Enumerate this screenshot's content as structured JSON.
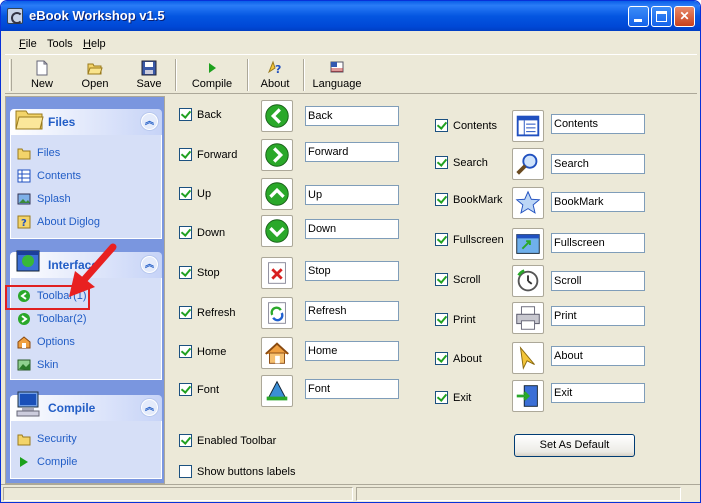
{
  "window": {
    "title": "eBook Workshop v1.5"
  },
  "menu": [
    {
      "label": "File",
      "u": "F",
      "rest": "ile"
    },
    {
      "label": "Tools",
      "u": "",
      "rest": "Tools"
    },
    {
      "label": "Help",
      "u": "H",
      "rest": "elp"
    }
  ],
  "toolbar": {
    "new": "New",
    "open": "Open",
    "save": "Save",
    "compile": "Compile",
    "about": "About",
    "language": "Language"
  },
  "sidebar": {
    "files": {
      "title": "Files",
      "items": [
        "Files",
        "Contents",
        "Splash",
        "About Diglog"
      ]
    },
    "interface": {
      "title": "Interface",
      "items": [
        "Toolbar(1)",
        "Toolbar(2)",
        "Options",
        "Skin"
      ]
    },
    "compile": {
      "title": "Compile",
      "items": [
        "Security",
        "Compile"
      ]
    }
  },
  "left_buttons": [
    {
      "label": "Back",
      "value": "Back",
      "checked": true,
      "icon": "arrow-left-icon"
    },
    {
      "label": "Forward",
      "value": "Forward",
      "checked": true,
      "icon": "arrow-right-icon"
    },
    {
      "label": "Up",
      "value": "Up",
      "checked": true,
      "icon": "arrow-up-icon"
    },
    {
      "label": "Down",
      "value": "Down",
      "checked": true,
      "icon": "arrow-down-icon"
    },
    {
      "label": "Stop",
      "value": "Stop",
      "checked": true,
      "icon": "stop-icon"
    },
    {
      "label": "Refresh",
      "value": "Refresh",
      "checked": true,
      "icon": "refresh-icon"
    },
    {
      "label": "Home",
      "value": "Home",
      "checked": true,
      "icon": "home-icon"
    },
    {
      "label": "Font",
      "value": "Font",
      "checked": true,
      "icon": "font-icon"
    }
  ],
  "right_buttons": [
    {
      "label": "Contents",
      "value": "Contents",
      "checked": true,
      "icon": "contents-icon"
    },
    {
      "label": "Search",
      "value": "Search",
      "checked": true,
      "icon": "search-icon"
    },
    {
      "label": "BookMark",
      "value": "BookMark",
      "checked": true,
      "icon": "bookmark-icon"
    },
    {
      "label": "Fullscreen",
      "value": "Fullscreen",
      "checked": true,
      "icon": "fullscreen-icon"
    },
    {
      "label": "Scroll",
      "value": "Scroll",
      "checked": true,
      "icon": "scroll-icon"
    },
    {
      "label": "Print",
      "value": "Print",
      "checked": true,
      "icon": "print-icon"
    },
    {
      "label": "About",
      "value": "About",
      "checked": true,
      "icon": "about-icon"
    },
    {
      "label": "Exit",
      "value": "Exit",
      "checked": true,
      "icon": "exit-icon"
    }
  ],
  "options": {
    "enabled_toolbar": {
      "label": "Enabled Toolbar",
      "checked": true
    },
    "show_labels": {
      "label": "Show buttons labels",
      "checked": false
    }
  },
  "set_default_label": "Set As Default"
}
